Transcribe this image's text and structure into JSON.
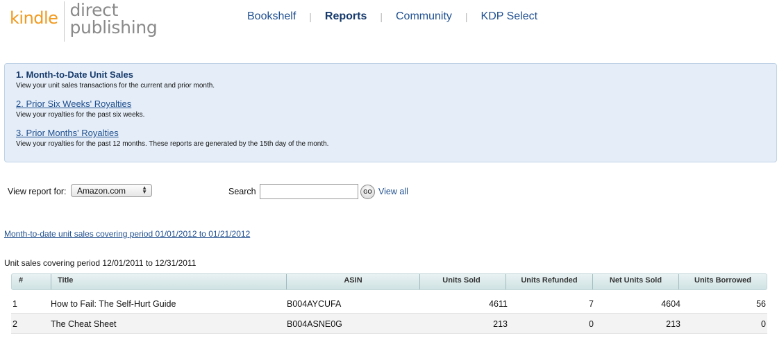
{
  "brand": {
    "kindle": "kindle",
    "line1": "direct",
    "line2": "publishing"
  },
  "nav": [
    {
      "label": "Bookshelf",
      "active": false
    },
    {
      "label": "Reports",
      "active": true
    },
    {
      "label": "Community",
      "active": false
    },
    {
      "label": "KDP Select",
      "active": false
    }
  ],
  "reports": [
    {
      "title": "1. Month-to-Date Unit Sales",
      "desc": "View your unit sales transactions for the current and prior month."
    },
    {
      "title": "2. Prior Six Weeks' Royalties",
      "desc": "View your royalties for the past six weeks."
    },
    {
      "title": "3. Prior Months' Royalties",
      "desc": "View your royalties for the past 12 months. These reports are generated by the 15th day of the month."
    }
  ],
  "controls": {
    "view_report_label": "View report for:",
    "marketplace_selected": "Amazon.com",
    "search_label": "Search",
    "search_value": "",
    "go_label": "GO",
    "view_all": "View all"
  },
  "mtd_link": "Month-to-date unit sales covering period 01/01/2012 to 01/21/2012",
  "period_text": "Unit sales covering period 12/01/2011 to 12/31/2011",
  "table": {
    "headers": [
      "#",
      "Title",
      "ASIN",
      "Units Sold",
      "Units Refunded",
      "Net Units Sold",
      "Units Borrowed"
    ],
    "rows": [
      [
        "1",
        "How to Fail: The Self-Hurt Guide",
        "B004AYCUFA",
        "4611",
        "7",
        "4604",
        "56"
      ],
      [
        "2",
        "The Cheat Sheet",
        "B004ASNE0G",
        "213",
        "0",
        "213",
        "0"
      ]
    ]
  }
}
